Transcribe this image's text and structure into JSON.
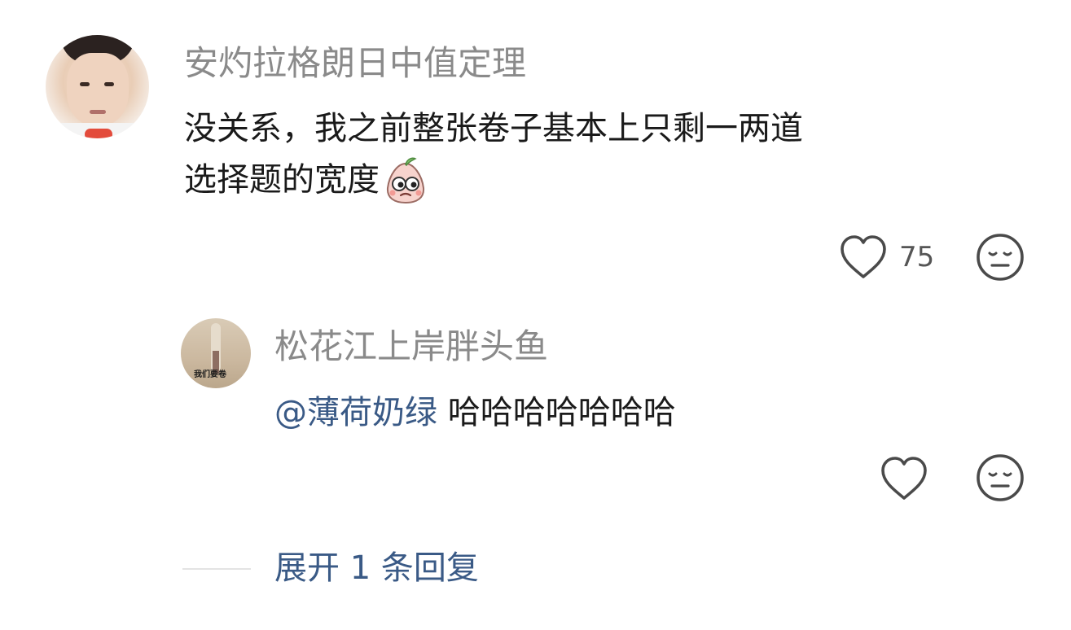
{
  "comment": {
    "username": "安灼拉格朗日中值定理",
    "text_line1": "没关系，我之前整张卷子基本上只剩一两道",
    "text_line2": "选择题的宽度",
    "emoji": "peach-face-emoji",
    "like_count": "75"
  },
  "reply": {
    "username": "松花江上岸胖头鱼",
    "mention": "@薄荷奶绿",
    "text": "哈哈哈哈哈哈哈",
    "avatar_caption": "我们要卷"
  },
  "expand_label": "展开 1 条回复",
  "icons": {
    "like": "heart-outline-icon",
    "react": "neutral-face-icon"
  },
  "colors": {
    "username": "#8a8a8a",
    "text": "#1a1a1a",
    "link": "#3a5a86",
    "icon": "#4a4a4a"
  }
}
